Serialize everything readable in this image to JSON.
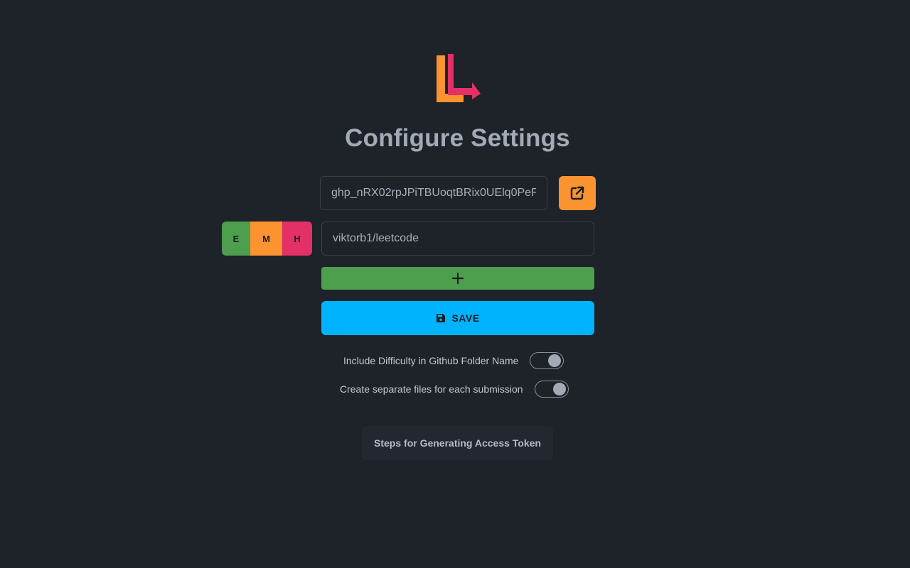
{
  "logo": {
    "name": "app-logo",
    "colors": {
      "primary": "#e33066",
      "secondary": "#fa9330"
    }
  },
  "header": {
    "title": "Configure Settings"
  },
  "token": {
    "value": "ghp_nRX02rpJPiTBUoqtBRix0UElq0PeF",
    "open_link_icon": "external-link-icon"
  },
  "difficulty": {
    "easy": "E",
    "medium": "M",
    "hard": "H",
    "colors": {
      "easy": "#4d9e4d",
      "medium": "#fa9330",
      "hard": "#e33066"
    }
  },
  "repo": {
    "value": "viktorb1/leetcode"
  },
  "add_button": {
    "icon": "plus-icon",
    "color": "#4d9e4d"
  },
  "save_button": {
    "label": "SAVE",
    "icon": "floppy-disk-icon",
    "color": "#00b3ff"
  },
  "toggles": [
    {
      "label": "Include Difficulty in Github Folder Name",
      "state": "on"
    },
    {
      "label": "Create separate files for each submission",
      "state": "on"
    }
  ],
  "steps_button": {
    "label": "Steps for Generating Access Token"
  }
}
